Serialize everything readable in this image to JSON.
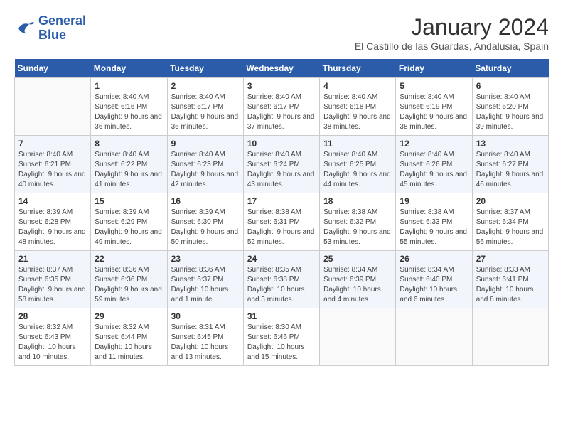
{
  "header": {
    "logo_line1": "General",
    "logo_line2": "Blue",
    "month": "January 2024",
    "location": "El Castillo de las Guardas, Andalusia, Spain"
  },
  "days_of_week": [
    "Sunday",
    "Monday",
    "Tuesday",
    "Wednesday",
    "Thursday",
    "Friday",
    "Saturday"
  ],
  "weeks": [
    [
      {
        "num": "",
        "sunrise": "",
        "sunset": "",
        "daylight": ""
      },
      {
        "num": "1",
        "sunrise": "Sunrise: 8:40 AM",
        "sunset": "Sunset: 6:16 PM",
        "daylight": "Daylight: 9 hours and 36 minutes."
      },
      {
        "num": "2",
        "sunrise": "Sunrise: 8:40 AM",
        "sunset": "Sunset: 6:17 PM",
        "daylight": "Daylight: 9 hours and 36 minutes."
      },
      {
        "num": "3",
        "sunrise": "Sunrise: 8:40 AM",
        "sunset": "Sunset: 6:17 PM",
        "daylight": "Daylight: 9 hours and 37 minutes."
      },
      {
        "num": "4",
        "sunrise": "Sunrise: 8:40 AM",
        "sunset": "Sunset: 6:18 PM",
        "daylight": "Daylight: 9 hours and 38 minutes."
      },
      {
        "num": "5",
        "sunrise": "Sunrise: 8:40 AM",
        "sunset": "Sunset: 6:19 PM",
        "daylight": "Daylight: 9 hours and 38 minutes."
      },
      {
        "num": "6",
        "sunrise": "Sunrise: 8:40 AM",
        "sunset": "Sunset: 6:20 PM",
        "daylight": "Daylight: 9 hours and 39 minutes."
      }
    ],
    [
      {
        "num": "7",
        "sunrise": "Sunrise: 8:40 AM",
        "sunset": "Sunset: 6:21 PM",
        "daylight": "Daylight: 9 hours and 40 minutes."
      },
      {
        "num": "8",
        "sunrise": "Sunrise: 8:40 AM",
        "sunset": "Sunset: 6:22 PM",
        "daylight": "Daylight: 9 hours and 41 minutes."
      },
      {
        "num": "9",
        "sunrise": "Sunrise: 8:40 AM",
        "sunset": "Sunset: 6:23 PM",
        "daylight": "Daylight: 9 hours and 42 minutes."
      },
      {
        "num": "10",
        "sunrise": "Sunrise: 8:40 AM",
        "sunset": "Sunset: 6:24 PM",
        "daylight": "Daylight: 9 hours and 43 minutes."
      },
      {
        "num": "11",
        "sunrise": "Sunrise: 8:40 AM",
        "sunset": "Sunset: 6:25 PM",
        "daylight": "Daylight: 9 hours and 44 minutes."
      },
      {
        "num": "12",
        "sunrise": "Sunrise: 8:40 AM",
        "sunset": "Sunset: 6:26 PM",
        "daylight": "Daylight: 9 hours and 45 minutes."
      },
      {
        "num": "13",
        "sunrise": "Sunrise: 8:40 AM",
        "sunset": "Sunset: 6:27 PM",
        "daylight": "Daylight: 9 hours and 46 minutes."
      }
    ],
    [
      {
        "num": "14",
        "sunrise": "Sunrise: 8:39 AM",
        "sunset": "Sunset: 6:28 PM",
        "daylight": "Daylight: 9 hours and 48 minutes."
      },
      {
        "num": "15",
        "sunrise": "Sunrise: 8:39 AM",
        "sunset": "Sunset: 6:29 PM",
        "daylight": "Daylight: 9 hours and 49 minutes."
      },
      {
        "num": "16",
        "sunrise": "Sunrise: 8:39 AM",
        "sunset": "Sunset: 6:30 PM",
        "daylight": "Daylight: 9 hours and 50 minutes."
      },
      {
        "num": "17",
        "sunrise": "Sunrise: 8:38 AM",
        "sunset": "Sunset: 6:31 PM",
        "daylight": "Daylight: 9 hours and 52 minutes."
      },
      {
        "num": "18",
        "sunrise": "Sunrise: 8:38 AM",
        "sunset": "Sunset: 6:32 PM",
        "daylight": "Daylight: 9 hours and 53 minutes."
      },
      {
        "num": "19",
        "sunrise": "Sunrise: 8:38 AM",
        "sunset": "Sunset: 6:33 PM",
        "daylight": "Daylight: 9 hours and 55 minutes."
      },
      {
        "num": "20",
        "sunrise": "Sunrise: 8:37 AM",
        "sunset": "Sunset: 6:34 PM",
        "daylight": "Daylight: 9 hours and 56 minutes."
      }
    ],
    [
      {
        "num": "21",
        "sunrise": "Sunrise: 8:37 AM",
        "sunset": "Sunset: 6:35 PM",
        "daylight": "Daylight: 9 hours and 58 minutes."
      },
      {
        "num": "22",
        "sunrise": "Sunrise: 8:36 AM",
        "sunset": "Sunset: 6:36 PM",
        "daylight": "Daylight: 9 hours and 59 minutes."
      },
      {
        "num": "23",
        "sunrise": "Sunrise: 8:36 AM",
        "sunset": "Sunset: 6:37 PM",
        "daylight": "Daylight: 10 hours and 1 minute."
      },
      {
        "num": "24",
        "sunrise": "Sunrise: 8:35 AM",
        "sunset": "Sunset: 6:38 PM",
        "daylight": "Daylight: 10 hours and 3 minutes."
      },
      {
        "num": "25",
        "sunrise": "Sunrise: 8:34 AM",
        "sunset": "Sunset: 6:39 PM",
        "daylight": "Daylight: 10 hours and 4 minutes."
      },
      {
        "num": "26",
        "sunrise": "Sunrise: 8:34 AM",
        "sunset": "Sunset: 6:40 PM",
        "daylight": "Daylight: 10 hours and 6 minutes."
      },
      {
        "num": "27",
        "sunrise": "Sunrise: 8:33 AM",
        "sunset": "Sunset: 6:41 PM",
        "daylight": "Daylight: 10 hours and 8 minutes."
      }
    ],
    [
      {
        "num": "28",
        "sunrise": "Sunrise: 8:32 AM",
        "sunset": "Sunset: 6:43 PM",
        "daylight": "Daylight: 10 hours and 10 minutes."
      },
      {
        "num": "29",
        "sunrise": "Sunrise: 8:32 AM",
        "sunset": "Sunset: 6:44 PM",
        "daylight": "Daylight: 10 hours and 11 minutes."
      },
      {
        "num": "30",
        "sunrise": "Sunrise: 8:31 AM",
        "sunset": "Sunset: 6:45 PM",
        "daylight": "Daylight: 10 hours and 13 minutes."
      },
      {
        "num": "31",
        "sunrise": "Sunrise: 8:30 AM",
        "sunset": "Sunset: 6:46 PM",
        "daylight": "Daylight: 10 hours and 15 minutes."
      },
      {
        "num": "",
        "sunrise": "",
        "sunset": "",
        "daylight": ""
      },
      {
        "num": "",
        "sunrise": "",
        "sunset": "",
        "daylight": ""
      },
      {
        "num": "",
        "sunrise": "",
        "sunset": "",
        "daylight": ""
      }
    ]
  ]
}
